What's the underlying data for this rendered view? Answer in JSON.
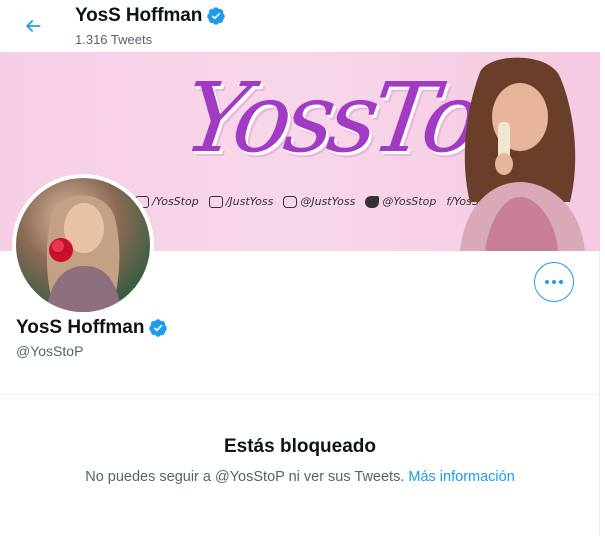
{
  "header": {
    "name": "YosS Hoffman",
    "tweet_count": "1.316 Tweets"
  },
  "banner": {
    "logo_text": "YossTop",
    "socials": [
      "/YosStop",
      "/JustYoss",
      "@JustYoss",
      "@YosStop",
      "f/YosStop"
    ]
  },
  "profile": {
    "name": "YosS Hoffman",
    "handle": "@YosStoP"
  },
  "blocked": {
    "title": "Estás bloqueado",
    "message": "No puedes seguir a @YosStoP ni ver sus Tweets. ",
    "link": "Más información"
  },
  "colors": {
    "accent": "#1d9bf0",
    "text": "#0f1419",
    "secondary": "#536471"
  }
}
